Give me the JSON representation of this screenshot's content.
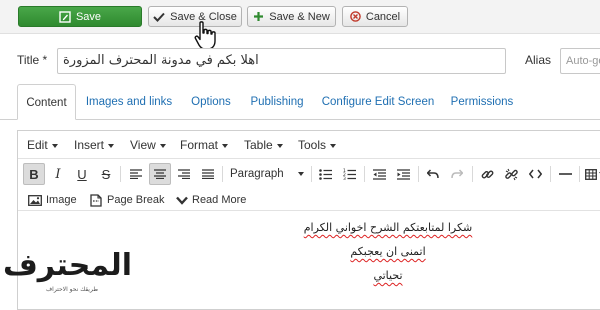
{
  "toolbar": {
    "save_label": "Save",
    "save_close_label": "Save & Close",
    "save_new_label": "Save & New",
    "cancel_label": "Cancel",
    "save_color": "#3c9a3c"
  },
  "form": {
    "title_label": "Title *",
    "title_value": "اهلا بكم في مدونة المحترف المزورة",
    "alias_label": "Alias",
    "alias_placeholder": "Auto-gen"
  },
  "tabs": [
    {
      "label": "Content",
      "active": true
    },
    {
      "label": "Images and links"
    },
    {
      "label": "Options"
    },
    {
      "label": "Publishing"
    },
    {
      "label": "Configure Edit Screen"
    },
    {
      "label": "Permissions"
    }
  ],
  "editor": {
    "menus": [
      "Edit",
      "Insert",
      "View",
      "Format",
      "Table",
      "Tools"
    ],
    "format_select": "Paragraph",
    "format_buttons": [
      {
        "icon": "bold-icon",
        "glyph": "B",
        "pressed": true
      },
      {
        "icon": "italic-icon",
        "glyph": "I"
      },
      {
        "icon": "underline-icon",
        "glyph": "U"
      },
      {
        "icon": "strikethrough-icon",
        "glyph": "S"
      },
      {
        "icon": "align-left-icon"
      },
      {
        "icon": "align-center-icon",
        "pressed": true
      },
      {
        "icon": "align-right-icon"
      },
      {
        "icon": "align-justify-icon"
      },
      {
        "icon": "bullet-list-icon"
      },
      {
        "icon": "numbered-list-icon"
      },
      {
        "icon": "outdent-icon"
      },
      {
        "icon": "indent-icon"
      },
      {
        "icon": "undo-icon"
      },
      {
        "icon": "redo-icon",
        "disabled": true
      },
      {
        "icon": "link-icon"
      },
      {
        "icon": "unlink-icon"
      },
      {
        "icon": "code-icon"
      },
      {
        "icon": "horizontal-rule-icon"
      },
      {
        "icon": "table-icon"
      }
    ],
    "insert_buttons": [
      {
        "icon": "image-icon",
        "label": "Image"
      },
      {
        "icon": "page-break-icon",
        "label": "Page Break"
      },
      {
        "icon": "read-more-icon",
        "label": "Read More"
      }
    ],
    "content_lines": [
      "شكرا لمتابعتكم الشرح اخواني الكرام",
      "اتمنى ان يعجبكم",
      "تحياتي"
    ]
  },
  "logo": {
    "word": "المحترف",
    "tagline": "طريقك نحو الاحتراف"
  }
}
